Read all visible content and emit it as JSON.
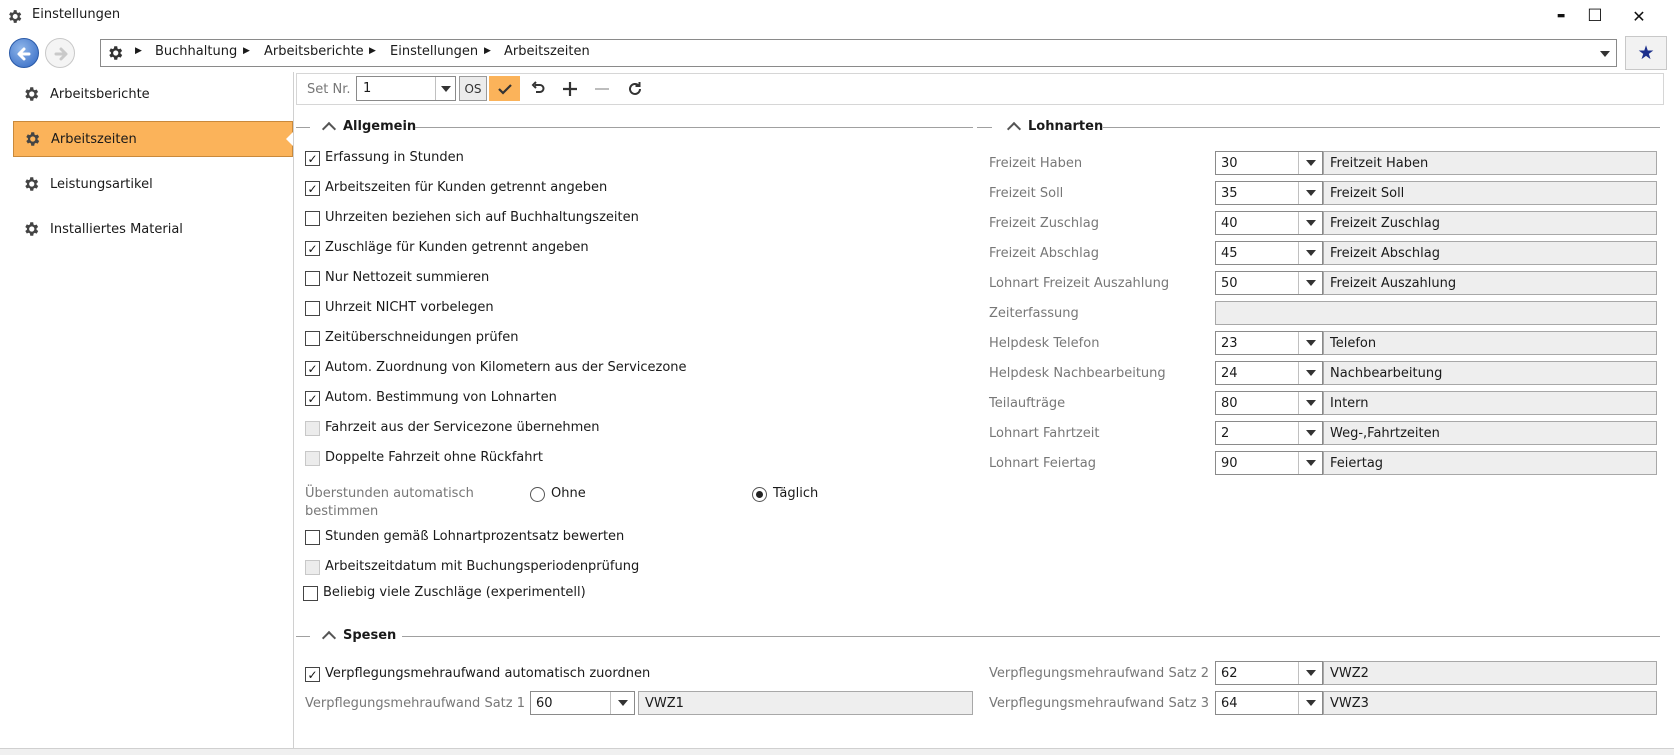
{
  "window": {
    "title": "Einstellungen",
    "controls": {
      "minimize": "▬",
      "maximize": "☐",
      "close": "✕"
    }
  },
  "navigation": {
    "breadcrumb": [
      "Buchhaltung",
      "Arbeitsberichte",
      "Einstellungen",
      "Arbeitszeiten"
    ],
    "favorite_icon": "★"
  },
  "sidebar": {
    "items": [
      {
        "label": "Arbeitsberichte",
        "active": false
      },
      {
        "label": "Arbeitszeiten",
        "active": true
      },
      {
        "label": "Leistungsartikel",
        "active": false
      },
      {
        "label": "Installiertes Material",
        "active": false
      }
    ]
  },
  "toolbar": {
    "set_label": "Set Nr.",
    "set_value": "1",
    "os_label": "OS"
  },
  "allgemein": {
    "title": "Allgemein",
    "checkboxes": [
      {
        "label": "Erfassung in Stunden",
        "checked": true,
        "disabled": false
      },
      {
        "label": "Arbeitszeiten für Kunden getrennt angeben",
        "checked": true,
        "disabled": false
      },
      {
        "label": "Uhrzeiten beziehen sich auf Buchhaltungszeiten",
        "checked": false,
        "disabled": false
      },
      {
        "label": "Zuschläge für Kunden getrennt angeben",
        "checked": true,
        "disabled": false
      },
      {
        "label": "Nur Nettozeit summieren",
        "checked": false,
        "disabled": false
      },
      {
        "label": "Uhrzeit NICHT vorbelegen",
        "checked": false,
        "disabled": false
      },
      {
        "label": "Zeitüberschneidungen prüfen",
        "checked": false,
        "disabled": false
      },
      {
        "label": "Autom. Zuordnung von Kilometern aus der Servicezone",
        "checked": true,
        "disabled": false
      },
      {
        "label": "Autom. Bestimmung von Lohnarten",
        "checked": true,
        "disabled": false
      },
      {
        "label": "Fahrzeit aus der Servicezone übernehmen",
        "checked": false,
        "disabled": true
      },
      {
        "label": "Doppelte Fahrzeit ohne Rückfahrt",
        "checked": false,
        "disabled": true
      }
    ],
    "overtime": {
      "label_line1": "Überstunden automatisch",
      "label_line2": "bestimmen",
      "options": [
        {
          "label": "Ohne",
          "checked": false
        },
        {
          "label": "Täglich",
          "checked": true
        }
      ]
    },
    "checkboxes_after": [
      {
        "label": "Stunden gemäß Lohnartprozentsatz bewerten",
        "checked": false,
        "disabled": false
      },
      {
        "label": "Arbeitszeitdatum mit Buchungsperiodenprüfung",
        "checked": false,
        "disabled": true
      },
      {
        "label": "Beliebig viele Zuschläge (experimentell)",
        "checked": false,
        "disabled": false
      }
    ]
  },
  "lohnarten": {
    "title": "Lohnarten",
    "rows": [
      {
        "label": "Freizeit Haben",
        "value": "30",
        "desc": "Freitzeit Haben"
      },
      {
        "label": "Freizeit Soll",
        "value": "35",
        "desc": "Freizeit Soll"
      },
      {
        "label": "Freizeit Zuschlag",
        "value": "40",
        "desc": "Freizeit Zuschlag"
      },
      {
        "label": "Freizeit Abschlag",
        "value": "45",
        "desc": "Freizeit Abschlag"
      },
      {
        "label": "Lohnart Freizeit Auszahlung",
        "value": "50",
        "desc": "Freizeit Auszahlung"
      },
      {
        "label": "Zeiterfassung",
        "value": null,
        "desc": ""
      },
      {
        "label": "Helpdesk Telefon",
        "value": "23",
        "desc": "Telefon"
      },
      {
        "label": "Helpdesk Nachbearbeitung",
        "value": "24",
        "desc": "Nachbearbeitung"
      },
      {
        "label": "Teilaufträge",
        "value": "80",
        "desc": "Intern"
      },
      {
        "label": "Lohnart Fahrtzeit",
        "value": "2",
        "desc": "Weg-,Fahrtzeiten"
      },
      {
        "label": "Lohnart Feiertag",
        "value": "90",
        "desc": "Feiertag"
      }
    ]
  },
  "spesen": {
    "title": "Spesen",
    "auto_assign": {
      "label": "Verpflegungsmehraufwand automatisch zuordnen",
      "checked": true
    },
    "satz1": {
      "label": "Verpflegungsmehraufwand Satz 1",
      "value": "60",
      "desc": "VWZ1"
    },
    "satz2": {
      "label": "Verpflegungsmehraufwand Satz 2",
      "value": "62",
      "desc": "VWZ2"
    },
    "satz3": {
      "label": "Verpflegungsmehraufwand Satz 3",
      "value": "64",
      "desc": "VWZ3"
    }
  },
  "colors": {
    "accent": "#fbb35a",
    "save_button": "#fbb35a",
    "back_button": "#2f66c2"
  }
}
